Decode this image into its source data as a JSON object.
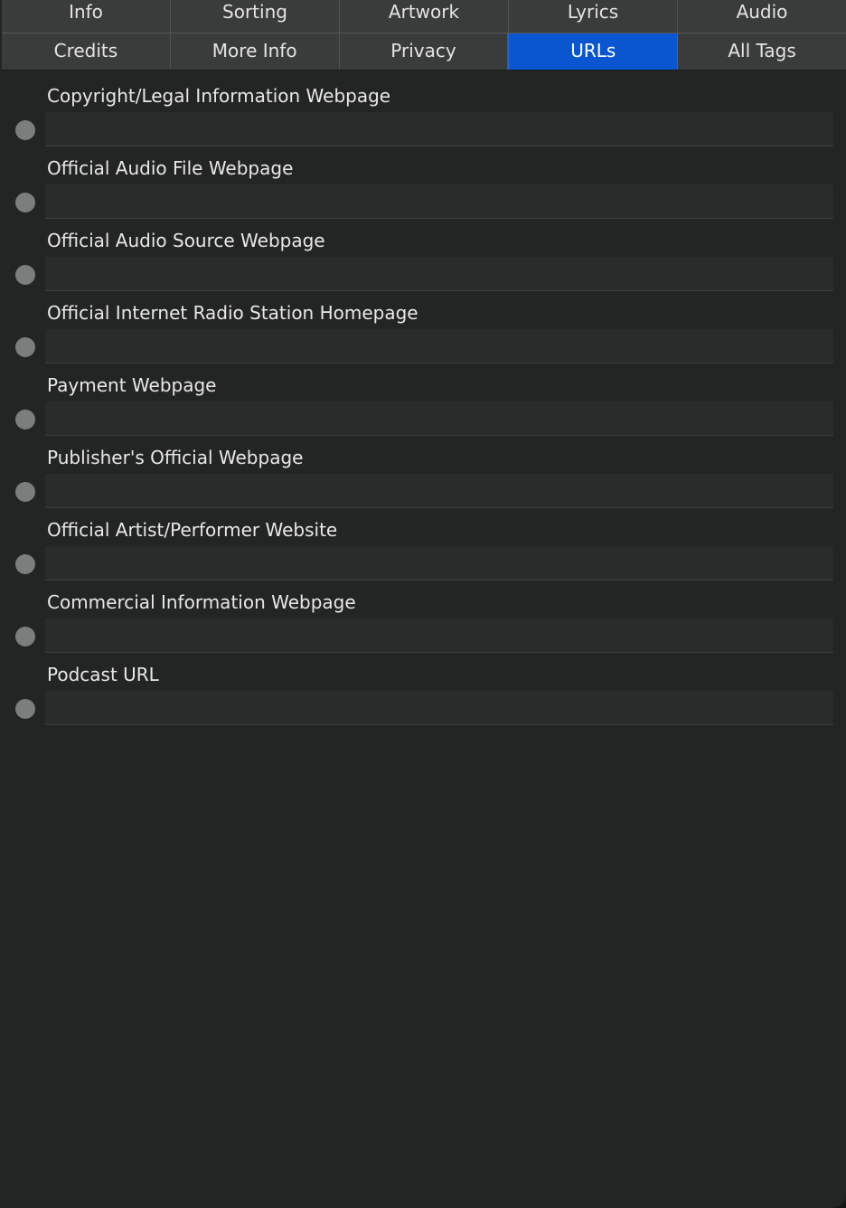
{
  "tabs": {
    "row1": [
      {
        "label": "Info",
        "selected": false
      },
      {
        "label": "Sorting",
        "selected": false
      },
      {
        "label": "Artwork",
        "selected": false
      },
      {
        "label": "Lyrics",
        "selected": false
      },
      {
        "label": "Audio",
        "selected": false
      }
    ],
    "row2": [
      {
        "label": "Credits",
        "selected": false
      },
      {
        "label": "More Info",
        "selected": false
      },
      {
        "label": "Privacy",
        "selected": false
      },
      {
        "label": "URLs",
        "selected": true
      },
      {
        "label": "All Tags",
        "selected": false
      }
    ]
  },
  "fields": [
    {
      "label": "Copyright/Legal Information Webpage",
      "value": "",
      "placeholder": ""
    },
    {
      "label": "Official Audio File Webpage",
      "value": "",
      "placeholder": ""
    },
    {
      "label": "Official Audio Source Webpage",
      "value": "",
      "placeholder": ""
    },
    {
      "label": "Official Internet Radio Station Homepage",
      "value": "",
      "placeholder": ""
    },
    {
      "label": "Payment Webpage",
      "value": "",
      "placeholder": ""
    },
    {
      "label": "Publisher's Official Webpage",
      "value": "",
      "placeholder": ""
    },
    {
      "label": "Official Artist/Performer Website",
      "value": "",
      "placeholder": ""
    },
    {
      "label": "Commercial Information Webpage",
      "value": "",
      "placeholder": ""
    },
    {
      "label": "Podcast URL",
      "value": "",
      "placeholder": ""
    }
  ],
  "colors": {
    "background": "#232424",
    "tab": "#3a3b3b",
    "tab_selected": "#0a56d0",
    "field": "#2a2b2b",
    "indicator": "#7c7d7d"
  }
}
